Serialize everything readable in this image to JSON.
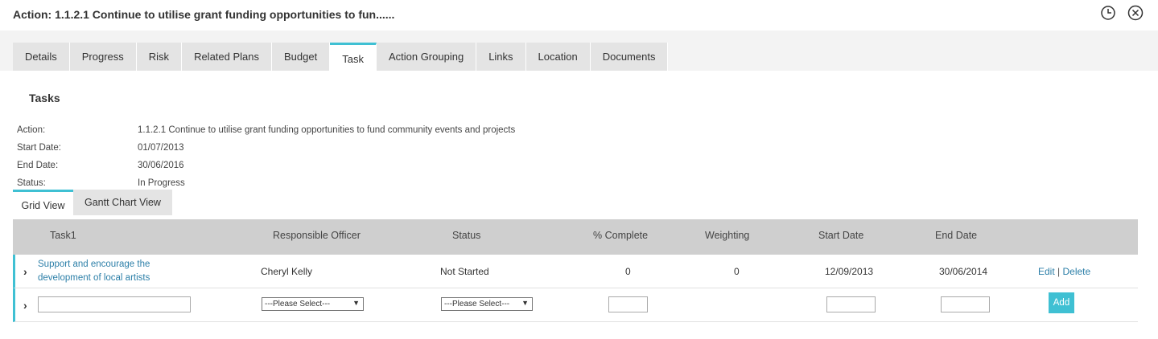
{
  "window": {
    "title": "Action: 1.1.2.1 Continue to utilise grant funding opportunities to fun......",
    "icons": [
      "clock-icon",
      "close-circle-icon"
    ]
  },
  "tabs": [
    {
      "label": "Details",
      "active": false
    },
    {
      "label": "Progress",
      "active": false
    },
    {
      "label": "Risk",
      "active": false
    },
    {
      "label": "Related Plans",
      "active": false
    },
    {
      "label": "Budget",
      "active": false
    },
    {
      "label": "Task",
      "active": true
    },
    {
      "label": "Action Grouping",
      "active": false
    },
    {
      "label": "Links",
      "active": false
    },
    {
      "label": "Location",
      "active": false
    },
    {
      "label": "Documents",
      "active": false
    }
  ],
  "section": {
    "title": "Tasks"
  },
  "info": [
    {
      "label": "Action:",
      "value": "1.1.2.1 Continue to utilise grant funding opportunities to fund community events and projects"
    },
    {
      "label": "Start Date:",
      "value": "01/07/2013"
    },
    {
      "label": "End Date:",
      "value": "30/06/2016"
    },
    {
      "label": "Status:",
      "value": "In Progress"
    }
  ],
  "view_tabs": [
    {
      "label": "Grid View",
      "active": true
    },
    {
      "label": "Gantt Chart View",
      "active": false
    }
  ],
  "grid": {
    "columns": [
      "Task1",
      "Responsible Officer",
      "Status",
      "% Complete",
      "Weighting",
      "Start Date",
      "End Date"
    ],
    "rows": [
      {
        "task_line1": "Support and encourage the",
        "task_line2": "development of local artists",
        "officer": "Cheryl Kelly",
        "status": "Not Started",
        "complete": "0",
        "weighting": "0",
        "start": "12/09/2013",
        "end": "30/06/2014",
        "edit_label": "Edit",
        "separator": "|",
        "delete_label": "Delete"
      }
    ],
    "new_row": {
      "task_value": "",
      "officer_select": "---Please Select---",
      "status_select": "---Please Select---",
      "complete_value": "",
      "start_value": "",
      "end_value": "",
      "add_label": "Add"
    }
  },
  "colors": {
    "accent": "#3fc0d3",
    "link": "#2c7fa8",
    "header_bg": "#cfcfcf",
    "tab_bg": "#e4e4e4"
  }
}
